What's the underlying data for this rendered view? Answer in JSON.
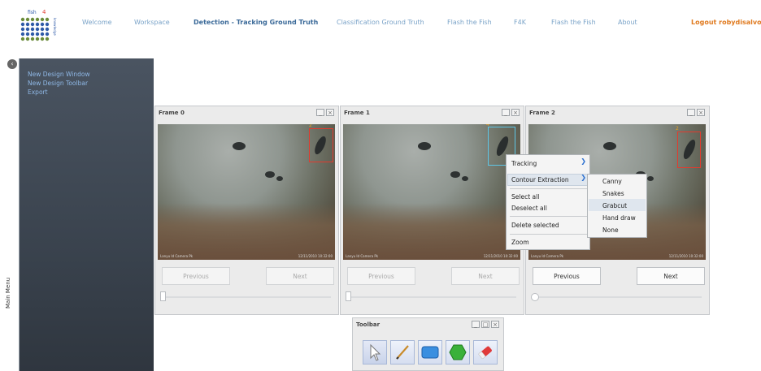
{
  "nav": {
    "items": [
      "Welcome",
      "Workspace",
      "Detection - Tracking Ground Truth",
      "Classification Ground Truth",
      "Flash the Fish",
      "F4K",
      "Flash the Fish",
      "About"
    ],
    "logout": "Logout robydisalvo"
  },
  "logo": {
    "text": "fish 4 knowledge",
    "icon": "fish4knowledge-logo"
  },
  "sidebar": {
    "label": "Main Menu",
    "collapse_icon": "chevron-left-icon",
    "links": [
      "New Design Window",
      "New Design Toolbar",
      "Export"
    ]
  },
  "frames": [
    {
      "title": "Frame 0",
      "bbox_id": "2",
      "bbox_color": "#e23b2e",
      "prev": "Previous",
      "next": "Next",
      "caption": "Lanyu Id Camera Pk",
      "stamp": "12/11/2010 10:32:00",
      "nav_enabled": false
    },
    {
      "title": "Frame 1",
      "bbox_id": "4",
      "bbox_color": "#5fc6e6",
      "prev": "Previous",
      "next": "Next",
      "caption": "Lanyu Id Camera Pk",
      "stamp": "12/11/2010 10:32:00",
      "nav_enabled": false
    },
    {
      "title": "Frame 2",
      "bbox_id": "2",
      "bbox_color": "#e23b2e",
      "prev": "Previous",
      "next": "Next",
      "caption": "Lanyu Id Camera Pk",
      "stamp": "12/11/2010 10:32:00",
      "nav_enabled": true
    }
  ],
  "context_menu": {
    "items": [
      "Tracking",
      "Contour Extraction",
      "Select all",
      "Deselect all",
      "Delete selected",
      "Zoom"
    ],
    "highlighted": "Contour Extraction",
    "submenu": [
      "Canny",
      "Snakes",
      "Grabcut",
      "Hand draw",
      "None"
    ],
    "submenu_highlighted": "Grabcut"
  },
  "toolbar": {
    "title": "Toolbar",
    "tools": [
      "pointer-tool-icon",
      "pencil-tool-icon",
      "rectangle-tool-icon",
      "polygon-tool-icon",
      "eraser-tool-icon"
    ]
  },
  "window_buttons": {
    "minimize": "_",
    "maximize": "□",
    "close": "×"
  },
  "colors": {
    "accent": "#3b6a99",
    "nav_link": "#7aa3c8",
    "logout": "#e07a1f",
    "sidebar_link": "#8fb8e6"
  }
}
